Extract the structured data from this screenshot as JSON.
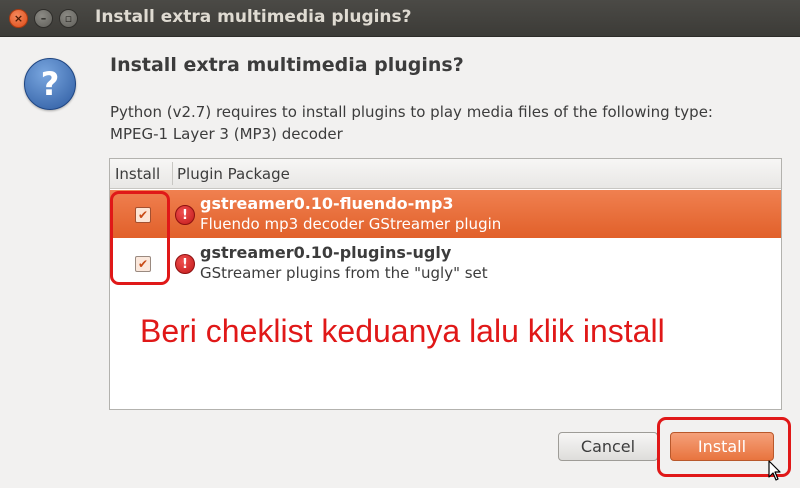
{
  "window": {
    "title": "Install extra multimedia plugins?",
    "close_glyph": "×",
    "min_glyph": "–",
    "max_glyph": "▫"
  },
  "dialog": {
    "icon": "question-icon",
    "icon_glyph": "?",
    "heading": "Install extra multimedia plugins?",
    "description_line1": "Python (v2.7) requires to install plugins to play media files of the following type:",
    "description_line2": "MPEG-1 Layer 3 (MP3) decoder"
  },
  "table": {
    "columns": [
      "Install",
      "Plugin Package"
    ],
    "rows": [
      {
        "checked": true,
        "name": "gstreamer0.10-fluendo-mp3",
        "description": "Fluendo mp3 decoder GStreamer plugin",
        "selected": true
      },
      {
        "checked": true,
        "name": "gstreamer0.10-plugins-ugly",
        "description": "GStreamer plugins from the \"ugly\" set",
        "selected": false
      }
    ],
    "check_glyph": "✔",
    "warn_glyph": "!"
  },
  "annotation": {
    "text": "Beri cheklist keduanya lalu klik install",
    "color": "#e01818"
  },
  "buttons": {
    "cancel": "Cancel",
    "install": "Install"
  },
  "colors": {
    "accent": "#e1602a",
    "titlebar": "#3c3b37"
  }
}
